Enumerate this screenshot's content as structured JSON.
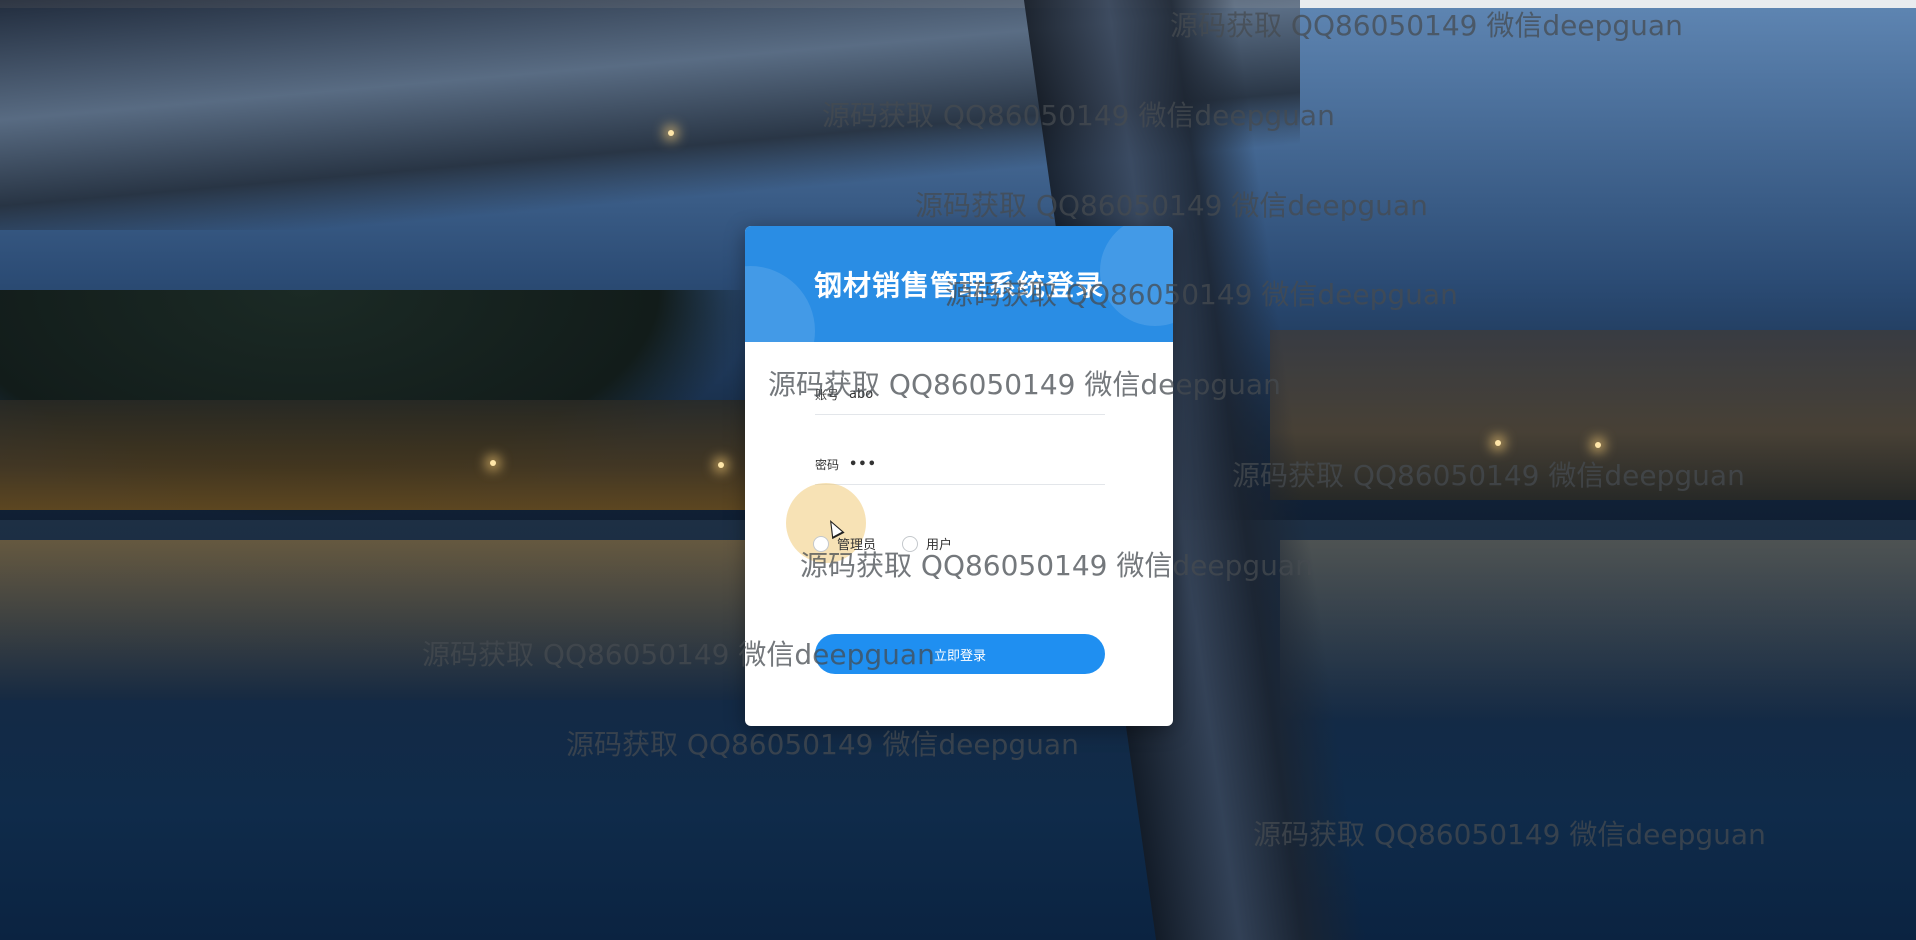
{
  "login": {
    "title": "钢材销售管理系统登录",
    "account_label": "账号",
    "account_value": "abo",
    "password_label": "密码",
    "password_value": "•••",
    "role_admin": "管理员",
    "role_user": "用户",
    "submit_label": "立即登录"
  },
  "watermark": {
    "text": "源码获取 QQ86050149 微信deepguan"
  },
  "colors": {
    "header_blue": "#2a8de4",
    "button_blue": "#1f8ff1"
  }
}
